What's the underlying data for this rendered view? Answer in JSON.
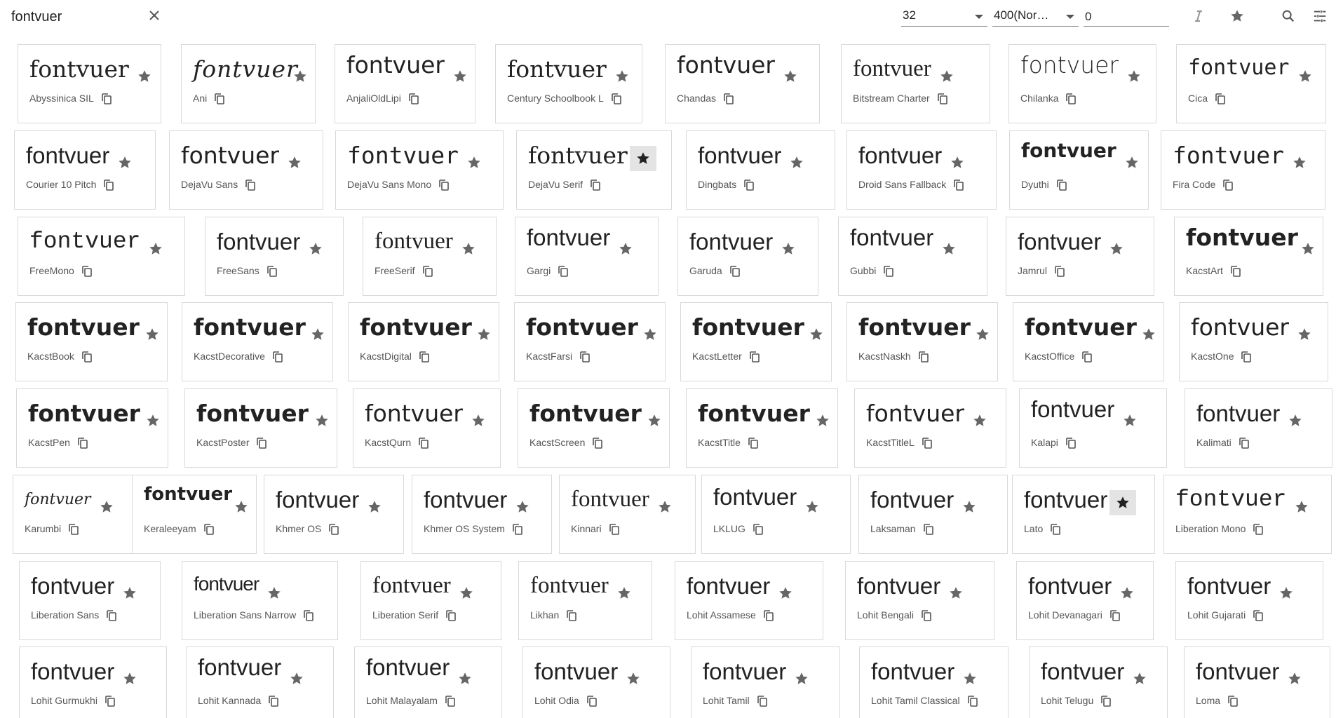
{
  "toolbar": {
    "search_value": "fontvuer",
    "font_size": "32",
    "font_weight": "400(Nor…",
    "third_value": "0",
    "icons": [
      "close-icon",
      "italic-icon",
      "star-icon",
      "search-icon",
      "tune-icon"
    ]
  },
  "sample_text": "fontvuer",
  "colors": {
    "star": "#666666",
    "star_active": "#222222",
    "active_bg": "#e4e4e4",
    "border": "#d9d9d9"
  },
  "fonts": [
    {
      "name": "Abyssinica SIL",
      "favorite": false
    },
    {
      "name": "Ani",
      "favorite": false
    },
    {
      "name": "AnjaliOldLipi",
      "favorite": false
    },
    {
      "name": "Century Schoolbook L",
      "favorite": false
    },
    {
      "name": "Chandas",
      "favorite": false
    },
    {
      "name": "Bitstream Charter",
      "favorite": false
    },
    {
      "name": "Chilanka",
      "favorite": false
    },
    {
      "name": "Cica",
      "favorite": false
    },
    {
      "name": "Courier 10 Pitch",
      "favorite": false
    },
    {
      "name": "DejaVu Sans",
      "favorite": false
    },
    {
      "name": "DejaVu Sans Mono",
      "favorite": false
    },
    {
      "name": "DejaVu Serif",
      "favorite": true
    },
    {
      "name": "Dingbats",
      "favorite": false
    },
    {
      "name": "Droid Sans Fallback",
      "favorite": false
    },
    {
      "name": "Dyuthi",
      "favorite": false
    },
    {
      "name": "Fira Code",
      "favorite": false
    },
    {
      "name": "FreeMono",
      "favorite": false
    },
    {
      "name": "FreeSans",
      "favorite": false
    },
    {
      "name": "FreeSerif",
      "favorite": false
    },
    {
      "name": "Gargi",
      "favorite": false
    },
    {
      "name": "Garuda",
      "favorite": false
    },
    {
      "name": "Gubbi",
      "favorite": false
    },
    {
      "name": "Jamrul",
      "favorite": false
    },
    {
      "name": "KacstArt",
      "favorite": false
    },
    {
      "name": "KacstBook",
      "favorite": false
    },
    {
      "name": "KacstDecorative",
      "favorite": false
    },
    {
      "name": "KacstDigital",
      "favorite": false
    },
    {
      "name": "KacstFarsi",
      "favorite": false
    },
    {
      "name": "KacstLetter",
      "favorite": false
    },
    {
      "name": "KacstNaskh",
      "favorite": false
    },
    {
      "name": "KacstOffice",
      "favorite": false
    },
    {
      "name": "KacstOne",
      "favorite": false
    },
    {
      "name": "KacstPen",
      "favorite": false
    },
    {
      "name": "KacstPoster",
      "favorite": false
    },
    {
      "name": "KacstQurn",
      "favorite": false
    },
    {
      "name": "KacstScreen",
      "favorite": false
    },
    {
      "name": "KacstTitle",
      "favorite": false
    },
    {
      "name": "KacstTitleL",
      "favorite": false
    },
    {
      "name": "Kalapi",
      "favorite": false
    },
    {
      "name": "Kalimati",
      "favorite": false
    },
    {
      "name": "Karumbi",
      "favorite": false
    },
    {
      "name": "Keraleeyam",
      "favorite": false
    },
    {
      "name": "Khmer OS",
      "favorite": false
    },
    {
      "name": "Khmer OS System",
      "favorite": false
    },
    {
      "name": "Kinnari",
      "favorite": false
    },
    {
      "name": "LKLUG",
      "favorite": false
    },
    {
      "name": "Laksaman",
      "favorite": false
    },
    {
      "name": "Lato",
      "favorite": true
    },
    {
      "name": "Liberation Mono",
      "favorite": false
    },
    {
      "name": "Liberation Sans",
      "favorite": false
    },
    {
      "name": "Liberation Sans Narrow",
      "favorite": false
    },
    {
      "name": "Liberation Serif",
      "favorite": false
    },
    {
      "name": "Likhan",
      "favorite": false
    },
    {
      "name": "Lohit Assamese",
      "favorite": false
    },
    {
      "name": "Lohit Bengali",
      "favorite": false
    },
    {
      "name": "Lohit Devanagari",
      "favorite": false
    },
    {
      "name": "Lohit Gujarati",
      "favorite": false
    },
    {
      "name": "Lohit Gurmukhi",
      "favorite": false
    },
    {
      "name": "Lohit Kannada",
      "favorite": false
    },
    {
      "name": "Lohit Malayalam",
      "favorite": false
    },
    {
      "name": "Lohit Odia",
      "favorite": false
    },
    {
      "name": "Lohit Tamil",
      "favorite": false
    },
    {
      "name": "Lohit Tamil Classical",
      "favorite": false
    },
    {
      "name": "Lohit Telugu",
      "favorite": false
    },
    {
      "name": "Loma",
      "favorite": false
    }
  ]
}
